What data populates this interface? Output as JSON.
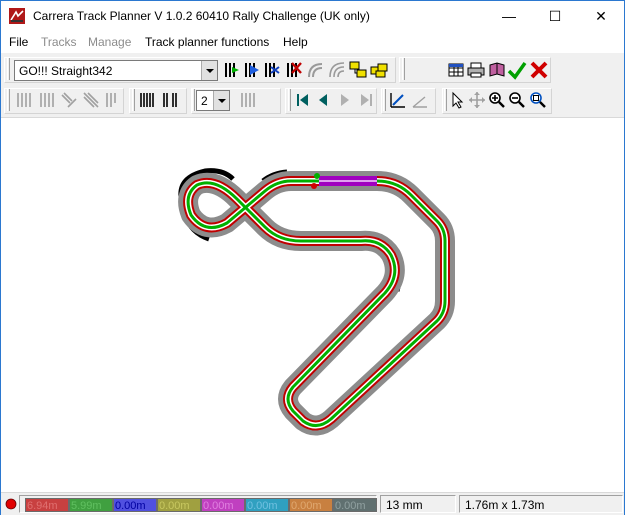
{
  "window": {
    "title": "Carrera Track Planner V 1.0.2 60410 Rally Challenge (UK only)",
    "minimize_glyph": "—",
    "maximize_glyph": "☐",
    "close_glyph": "✕"
  },
  "menu": {
    "items": [
      {
        "label": "File",
        "enabled": true
      },
      {
        "label": "Tracks",
        "enabled": false
      },
      {
        "label": "Manage",
        "enabled": false
      },
      {
        "label": "Track planner functions",
        "enabled": true
      },
      {
        "label": "Help",
        "enabled": true
      }
    ]
  },
  "toolbar": {
    "track_select_value": "GO!!! Straight342",
    "lane_count_value": "2"
  },
  "status": {
    "lengths": [
      {
        "value": "6.94m",
        "bg": "#c84040",
        "fg": "#e07070"
      },
      {
        "value": "5.99m",
        "bg": "#40a040",
        "fg": "#60c060"
      },
      {
        "value": "0.00m",
        "bg": "#5050e0",
        "fg": "#0000a0"
      },
      {
        "value": "0.00m",
        "bg": "#a0a040",
        "fg": "#c8c860"
      },
      {
        "value": "0.00m",
        "bg": "#c040c0",
        "fg": "#e080e0"
      },
      {
        "value": "0.00m",
        "bg": "#30a0c0",
        "fg": "#70c0e0"
      },
      {
        "value": "0.00m",
        "bg": "#c88040",
        "fg": "#e0a870"
      },
      {
        "value": "0.00m",
        "bg": "#607070",
        "fg": "#90a0a0"
      }
    ],
    "grid_size": "13 mm",
    "dimensions": "1.76m x 1.73m"
  },
  "colors": {
    "accent_red": "#d00000",
    "track_grey": "#8c8c8c",
    "lane_red": "#c00000",
    "lane_green": "#00b000",
    "purple": "#a000c0",
    "border_black": "#000000"
  }
}
